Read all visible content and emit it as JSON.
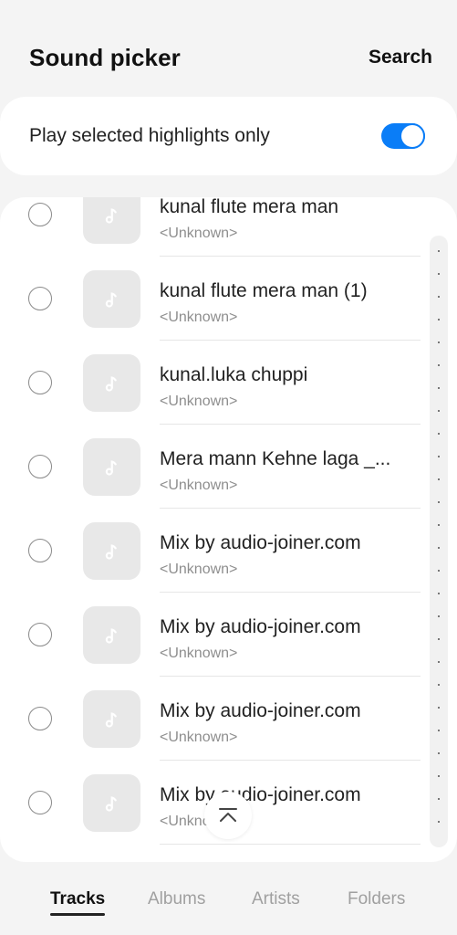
{
  "header": {
    "title": "Sound picker",
    "search_label": "Search"
  },
  "toggle_setting": {
    "label": "Play selected highlights only",
    "enabled": true,
    "accent_color": "#0a7df7"
  },
  "tracks": [
    {
      "title": "kunal flute mera man",
      "artist": "<Unknown>",
      "selected": false,
      "icon": "music-note-icon"
    },
    {
      "title": "kunal flute mera man (1)",
      "artist": "<Unknown>",
      "selected": false,
      "icon": "music-note-icon"
    },
    {
      "title": "kunal.luka chuppi",
      "artist": "<Unknown>",
      "selected": false,
      "icon": "music-note-icon"
    },
    {
      "title": "Mera mann Kehne laga _...",
      "artist": "<Unknown>",
      "selected": false,
      "icon": "music-note-icon"
    },
    {
      "title": "Mix by audio-joiner.com",
      "artist": "<Unknown>",
      "selected": false,
      "icon": "music-note-icon"
    },
    {
      "title": "Mix by audio-joiner.com",
      "artist": "<Unknown>",
      "selected": false,
      "icon": "music-note-icon"
    },
    {
      "title": "Mix by audio-joiner.com",
      "artist": "<Unknown>",
      "selected": false,
      "icon": "music-note-icon"
    },
    {
      "title": "Mix by audio-joiner.com",
      "artist": "<Unknown>",
      "selected": false,
      "icon": "music-note-icon"
    }
  ],
  "scroll_top_icon": "chevron-up-to-top-icon",
  "tabs": [
    {
      "label": "Tracks",
      "active": true
    },
    {
      "label": "Albums",
      "active": false
    },
    {
      "label": "Artists",
      "active": false
    },
    {
      "label": "Folders",
      "active": false
    }
  ]
}
